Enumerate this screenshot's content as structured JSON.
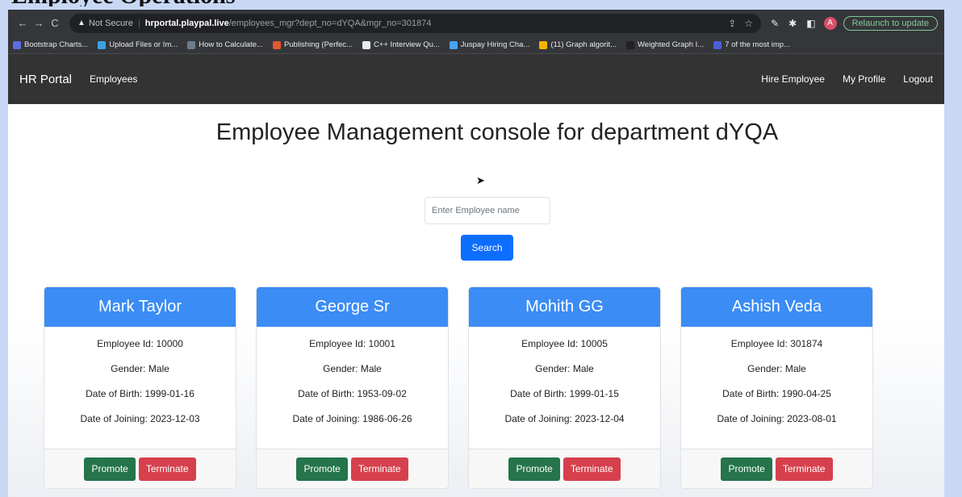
{
  "slide": {
    "title": "Employee Operations"
  },
  "browser": {
    "nav": {
      "back": "←",
      "forward": "→",
      "reload": "C"
    },
    "address": {
      "warning_icon": "▲",
      "security_label": "Not Secure",
      "host": "hrportal.playpal.live",
      "path": "/employees_mgr?dept_no=dYQA&mgr_no=301874"
    },
    "avatar_letter": "A",
    "relaunch_label": "Relaunch to update",
    "bookmarks": [
      {
        "label": "Bootstrap Charts...",
        "color": "#5b6ee1"
      },
      {
        "label": "Upload Files or Im...",
        "color": "#3aa3e3"
      },
      {
        "label": "How to Calculate...",
        "color": "#6a7b8c"
      },
      {
        "label": "Publishing (Perfec...",
        "color": "#e4572e"
      },
      {
        "label": "C++ Interview Qu...",
        "color": "#e8eaed"
      },
      {
        "label": "Juspay Hiring Cha...",
        "color": "#4aa3f0"
      },
      {
        "label": "(11) Graph algorit...",
        "color": "#f4b400"
      },
      {
        "label": "Weighted Graph I...",
        "color": "#222222"
      },
      {
        "label": "7 of the most imp...",
        "color": "#4c5fd5"
      }
    ]
  },
  "app": {
    "brand": "HR Portal",
    "nav_employees": "Employees",
    "nav_hire": "Hire Employee",
    "nav_profile": "My Profile",
    "nav_logout": "Logout"
  },
  "main": {
    "title": "Employee Management console for department dYQA",
    "search_placeholder": "Enter Employee name",
    "search_button": "Search"
  },
  "employees": [
    {
      "name": "Mark Taylor",
      "id": "Employee Id: 10000",
      "gender": "Gender: Male",
      "dob": "Date of Birth: 1999-01-16",
      "doj": "Date of Joining: 2023-12-03"
    },
    {
      "name": "George Sr",
      "id": "Employee Id: 10001",
      "gender": "Gender: Male",
      "dob": "Date of Birth: 1953-09-02",
      "doj": "Date of Joining: 1986-06-26"
    },
    {
      "name": "Mohith GG",
      "id": "Employee Id: 10005",
      "gender": "Gender: Male",
      "dob": "Date of Birth: 1999-01-15",
      "doj": "Date of Joining: 2023-12-04"
    },
    {
      "name": "Ashish Veda",
      "id": "Employee Id: 301874",
      "gender": "Gender: Male",
      "dob": "Date of Birth: 1990-04-25",
      "doj": "Date of Joining: 2023-08-01"
    }
  ],
  "card_actions": {
    "promote": "Promote",
    "terminate": "Terminate"
  }
}
